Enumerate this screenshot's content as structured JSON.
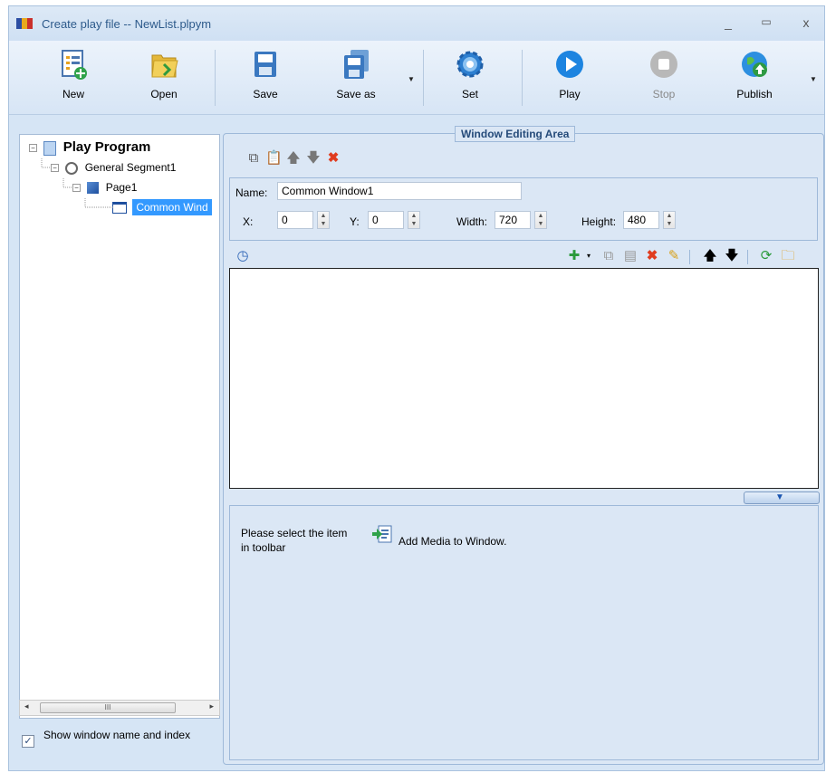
{
  "window": {
    "title": "Create play file -- NewList.plpym"
  },
  "toolbar": {
    "new": "New",
    "open": "Open",
    "save": "Save",
    "save_as": "Save as",
    "set": "Set",
    "play": "Play",
    "stop": "Stop",
    "publish": "Publish"
  },
  "tree": {
    "root": "Play Program",
    "segment": "General Segment1",
    "page": "Page1",
    "window": "Common Wind",
    "scroll_label": "III"
  },
  "show_option": {
    "label": "Show window name and index",
    "checked": true
  },
  "editing_area": {
    "title": "Window Editing Area",
    "name_label": "Name:",
    "name_value": "Common Window1",
    "x_label": "X:",
    "x_value": "0",
    "y_label": "Y:",
    "y_value": "0",
    "width_label": "Width:",
    "width_value": "720",
    "height_label": "Height:",
    "height_value": "480"
  },
  "hint": {
    "text": "Please select the item in toolbar",
    "action": "Add Media to Window."
  },
  "colors": {
    "accent": "#3399ff",
    "selection": "#3399ff",
    "panel": "#dbe7f5",
    "delete_red": "#e03c1f"
  }
}
